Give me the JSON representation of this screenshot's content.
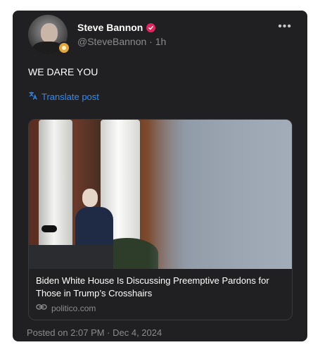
{
  "post": {
    "author": {
      "name": "Steve Bannon",
      "handle": "@SteveBannon",
      "time": "1h"
    },
    "text": "WE DARE YOU",
    "translate_label": "Translate post",
    "more_label": "•••",
    "link_card": {
      "headline": "Biden White House Is Discussing Preemptive Pardons for Those in Trump’s Crosshairs",
      "domain": "politico.com"
    },
    "posted_label": "Posted on 2:07 PM · Dec 4, 2024"
  },
  "colors": {
    "card_background": "#202022",
    "link_blue": "#2f8bf5",
    "verified_red": "#e0245e",
    "muted_text": "#8b8b8f"
  },
  "icons": {
    "verified": "verified-check-icon",
    "translate": "translate-icon",
    "link": "link-icon",
    "more": "more-options-icon",
    "badge": "gold-badge-icon"
  }
}
